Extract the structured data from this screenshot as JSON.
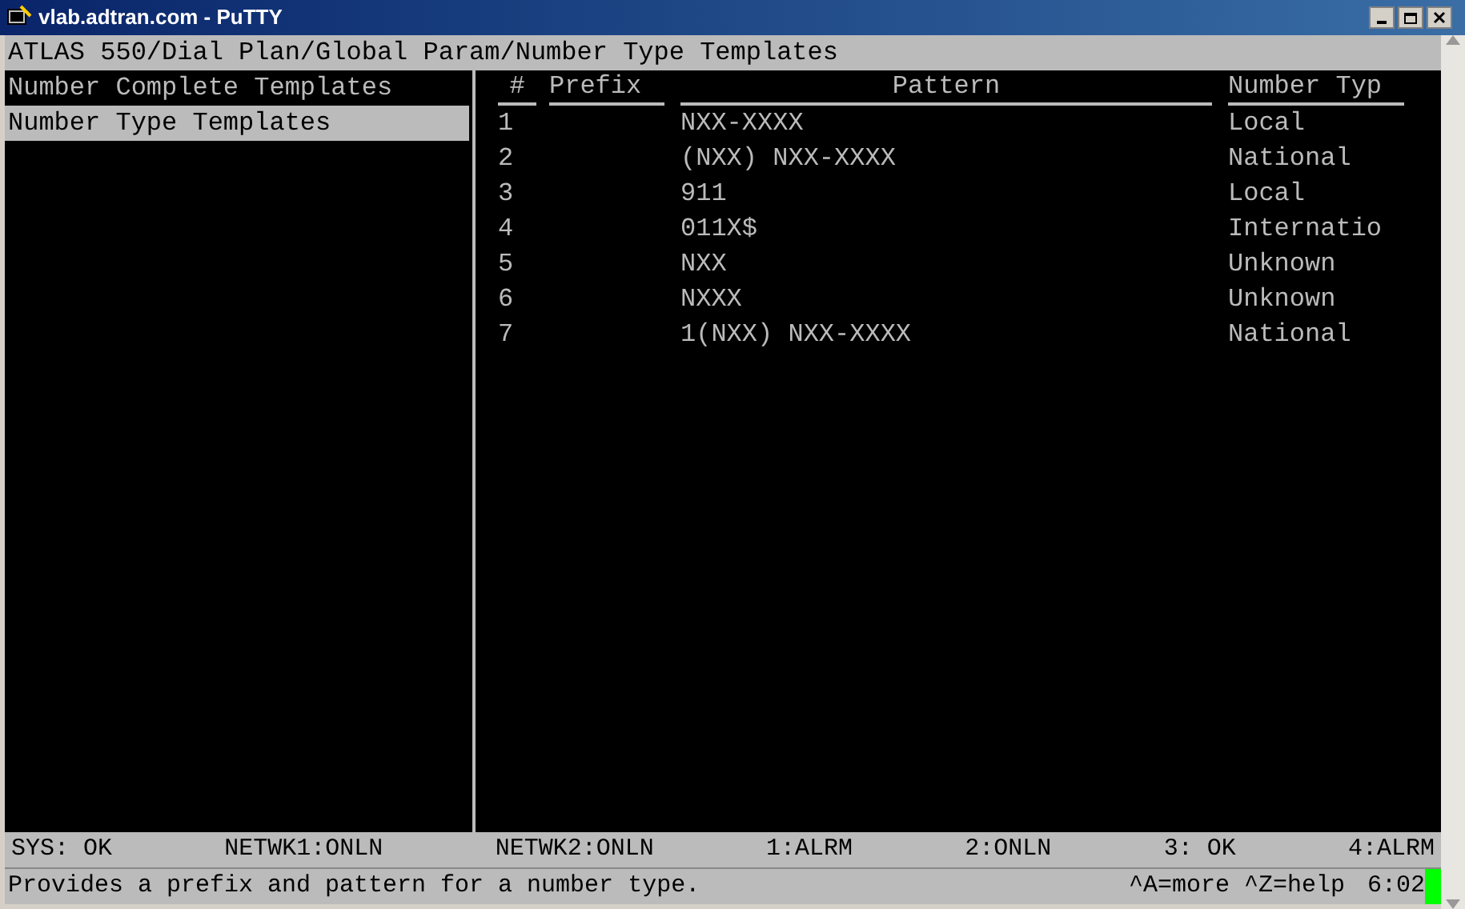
{
  "window": {
    "title": "vlab.adtran.com - PuTTY"
  },
  "path": "ATLAS 550/Dial Plan/Global Param/Number Type Templates",
  "menu": [
    {
      "label": "Number Complete Templates",
      "selected": false
    },
    {
      "label": "Number Type Templates",
      "selected": true
    }
  ],
  "table": {
    "columns": [
      "#",
      "Prefix",
      "Pattern",
      "Number Typ"
    ],
    "rows": [
      {
        "index": "1",
        "pattern": "NXX-XXXX",
        "type": "Local"
      },
      {
        "index": "2",
        "pattern": "(NXX) NXX-XXXX",
        "type": "National"
      },
      {
        "index": "3",
        "pattern": "911",
        "type": "Local"
      },
      {
        "index": "4",
        "pattern": "011X$",
        "type": "Internatio"
      },
      {
        "index": "5",
        "pattern": "NXX",
        "type": "Unknown"
      },
      {
        "index": "6",
        "pattern": "NXXX",
        "type": "Unknown"
      },
      {
        "index": "7",
        "pattern": "1(NXX) NXX-XXXX",
        "type": "National"
      }
    ]
  },
  "status_bar": [
    "SYS: OK",
    "NETWK1:ONLN",
    "NETWK2:ONLN",
    "1:ALRM",
    "2:ONLN",
    "3: OK",
    "4:ALRM"
  ],
  "help": {
    "text": "Provides a prefix and pattern for a number type.",
    "keys": "^A=more ^Z=help",
    "time": "6:02"
  }
}
